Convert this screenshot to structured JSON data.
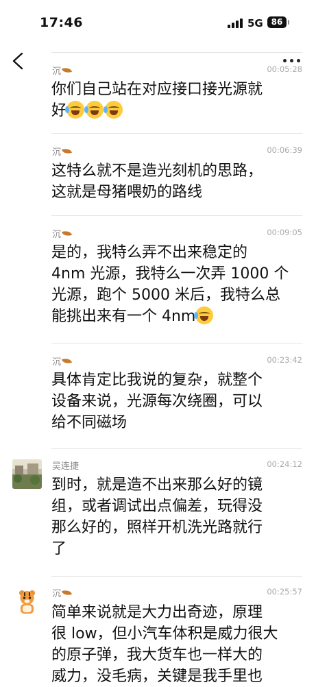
{
  "status_bar": {
    "time": "17:46",
    "network": "5G",
    "battery": "86"
  },
  "messages": [
    {
      "sender": "沉",
      "time": "00:05:28",
      "lines": [
        "你们自己站在对应接口接光源就",
        "好"
      ],
      "emoji_count": 3
    },
    {
      "sender": "沉",
      "time": "00:06:39",
      "lines": [
        "这特么就不是造光刻机的思路，",
        "这就是母猪喂奶的路线"
      ]
    },
    {
      "sender": "沉",
      "time": "00:09:05",
      "lines": [
        "是的，我特么弄不出来稳定的",
        "4nm 光源，我特么一次弄 1000 个",
        "光源，跑个 5000 米后，我特么总",
        "能挑出来有一个 4nm"
      ],
      "emoji_count": 1
    },
    {
      "sender": "沉",
      "time": "00:23:42",
      "lines": [
        "具体肯定比我说的复杂，就整个",
        "设备来说，光源每次绕圈，可以",
        "给不同磁场"
      ]
    },
    {
      "sender": "吴连捷",
      "time": "00:24:12",
      "lines": [
        "到时，就是造不出来那么好的镜",
        "组，或者调试出点偏差，玩得没",
        "那么好的，照样开机洗光路就行",
        "了"
      ]
    },
    {
      "sender": "沉",
      "time": "00:25:57",
      "lines": [
        "简单来说就是大力出奇迹，原理",
        "很 low，但小汽车体积是威力很大",
        "的原子弹，我大货车也一样大的",
        "威力，没毛病，关键是我手里也"
      ]
    }
  ]
}
